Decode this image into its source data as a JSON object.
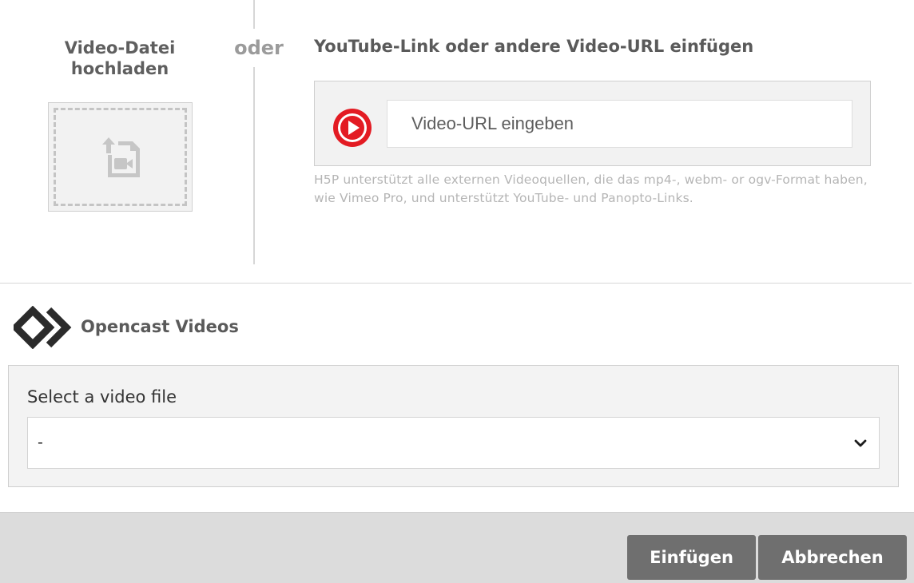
{
  "upload": {
    "title": "Video-Datei hochladen",
    "icon": "video-file-upload-icon"
  },
  "separator_label": "oder",
  "url_section": {
    "heading": "YouTube-Link oder andere Video-URL einfügen",
    "placeholder": "Video-URL eingeben",
    "value": "",
    "help_text": "H5P unterstützt alle externen Videoquellen, die das mp4-, webm- or ogv-Format haben, wie Vimeo Pro, und unterstützt YouTube- und Panopto-Links.",
    "icon": "youtube-play-icon",
    "icon_color": "#e31b23"
  },
  "opencast": {
    "title": "Opencast Videos",
    "logo": "opencast-logo-icon",
    "select_label": "Select a video file",
    "selected_value": "-"
  },
  "footer": {
    "insert_label": "Einfügen",
    "cancel_label": "Abbrechen"
  },
  "colors": {
    "button_bg": "#6f6f6f",
    "footer_bg": "#dcdcdc",
    "panel_bg": "#f2f2f2"
  }
}
